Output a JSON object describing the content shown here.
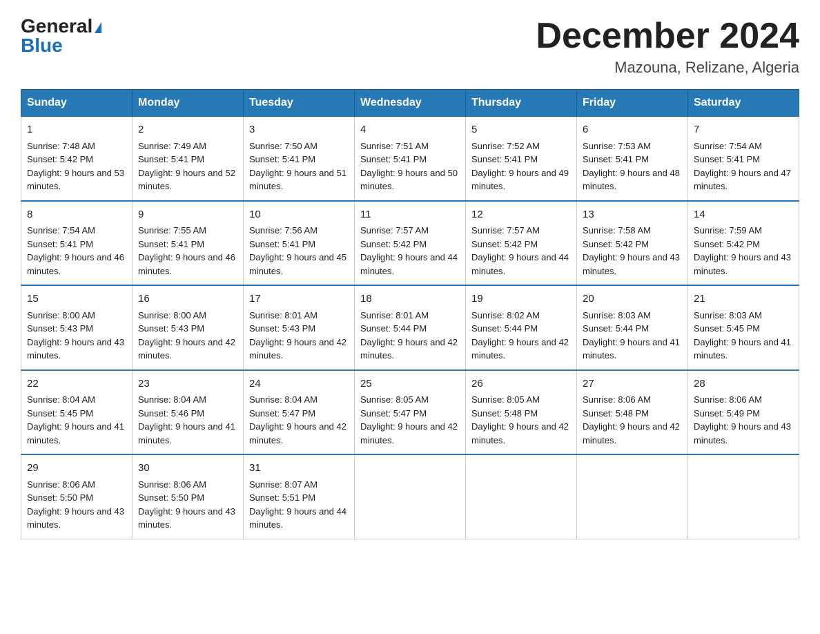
{
  "header": {
    "logo_general": "General",
    "logo_blue": "Blue",
    "month_title": "December 2024",
    "location": "Mazouna, Relizane, Algeria"
  },
  "weekdays": [
    "Sunday",
    "Monday",
    "Tuesday",
    "Wednesday",
    "Thursday",
    "Friday",
    "Saturday"
  ],
  "weeks": [
    [
      {
        "day": "1",
        "sunrise": "7:48 AM",
        "sunset": "5:42 PM",
        "daylight": "9 hours and 53 minutes."
      },
      {
        "day": "2",
        "sunrise": "7:49 AM",
        "sunset": "5:41 PM",
        "daylight": "9 hours and 52 minutes."
      },
      {
        "day": "3",
        "sunrise": "7:50 AM",
        "sunset": "5:41 PM",
        "daylight": "9 hours and 51 minutes."
      },
      {
        "day": "4",
        "sunrise": "7:51 AM",
        "sunset": "5:41 PM",
        "daylight": "9 hours and 50 minutes."
      },
      {
        "day": "5",
        "sunrise": "7:52 AM",
        "sunset": "5:41 PM",
        "daylight": "9 hours and 49 minutes."
      },
      {
        "day": "6",
        "sunrise": "7:53 AM",
        "sunset": "5:41 PM",
        "daylight": "9 hours and 48 minutes."
      },
      {
        "day": "7",
        "sunrise": "7:54 AM",
        "sunset": "5:41 PM",
        "daylight": "9 hours and 47 minutes."
      }
    ],
    [
      {
        "day": "8",
        "sunrise": "7:54 AM",
        "sunset": "5:41 PM",
        "daylight": "9 hours and 46 minutes."
      },
      {
        "day": "9",
        "sunrise": "7:55 AM",
        "sunset": "5:41 PM",
        "daylight": "9 hours and 46 minutes."
      },
      {
        "day": "10",
        "sunrise": "7:56 AM",
        "sunset": "5:41 PM",
        "daylight": "9 hours and 45 minutes."
      },
      {
        "day": "11",
        "sunrise": "7:57 AM",
        "sunset": "5:42 PM",
        "daylight": "9 hours and 44 minutes."
      },
      {
        "day": "12",
        "sunrise": "7:57 AM",
        "sunset": "5:42 PM",
        "daylight": "9 hours and 44 minutes."
      },
      {
        "day": "13",
        "sunrise": "7:58 AM",
        "sunset": "5:42 PM",
        "daylight": "9 hours and 43 minutes."
      },
      {
        "day": "14",
        "sunrise": "7:59 AM",
        "sunset": "5:42 PM",
        "daylight": "9 hours and 43 minutes."
      }
    ],
    [
      {
        "day": "15",
        "sunrise": "8:00 AM",
        "sunset": "5:43 PM",
        "daylight": "9 hours and 43 minutes."
      },
      {
        "day": "16",
        "sunrise": "8:00 AM",
        "sunset": "5:43 PM",
        "daylight": "9 hours and 42 minutes."
      },
      {
        "day": "17",
        "sunrise": "8:01 AM",
        "sunset": "5:43 PM",
        "daylight": "9 hours and 42 minutes."
      },
      {
        "day": "18",
        "sunrise": "8:01 AM",
        "sunset": "5:44 PM",
        "daylight": "9 hours and 42 minutes."
      },
      {
        "day": "19",
        "sunrise": "8:02 AM",
        "sunset": "5:44 PM",
        "daylight": "9 hours and 42 minutes."
      },
      {
        "day": "20",
        "sunrise": "8:03 AM",
        "sunset": "5:44 PM",
        "daylight": "9 hours and 41 minutes."
      },
      {
        "day": "21",
        "sunrise": "8:03 AM",
        "sunset": "5:45 PM",
        "daylight": "9 hours and 41 minutes."
      }
    ],
    [
      {
        "day": "22",
        "sunrise": "8:04 AM",
        "sunset": "5:45 PM",
        "daylight": "9 hours and 41 minutes."
      },
      {
        "day": "23",
        "sunrise": "8:04 AM",
        "sunset": "5:46 PM",
        "daylight": "9 hours and 41 minutes."
      },
      {
        "day": "24",
        "sunrise": "8:04 AM",
        "sunset": "5:47 PM",
        "daylight": "9 hours and 42 minutes."
      },
      {
        "day": "25",
        "sunrise": "8:05 AM",
        "sunset": "5:47 PM",
        "daylight": "9 hours and 42 minutes."
      },
      {
        "day": "26",
        "sunrise": "8:05 AM",
        "sunset": "5:48 PM",
        "daylight": "9 hours and 42 minutes."
      },
      {
        "day": "27",
        "sunrise": "8:06 AM",
        "sunset": "5:48 PM",
        "daylight": "9 hours and 42 minutes."
      },
      {
        "day": "28",
        "sunrise": "8:06 AM",
        "sunset": "5:49 PM",
        "daylight": "9 hours and 43 minutes."
      }
    ],
    [
      {
        "day": "29",
        "sunrise": "8:06 AM",
        "sunset": "5:50 PM",
        "daylight": "9 hours and 43 minutes."
      },
      {
        "day": "30",
        "sunrise": "8:06 AM",
        "sunset": "5:50 PM",
        "daylight": "9 hours and 43 minutes."
      },
      {
        "day": "31",
        "sunrise": "8:07 AM",
        "sunset": "5:51 PM",
        "daylight": "9 hours and 44 minutes."
      },
      null,
      null,
      null,
      null
    ]
  ]
}
